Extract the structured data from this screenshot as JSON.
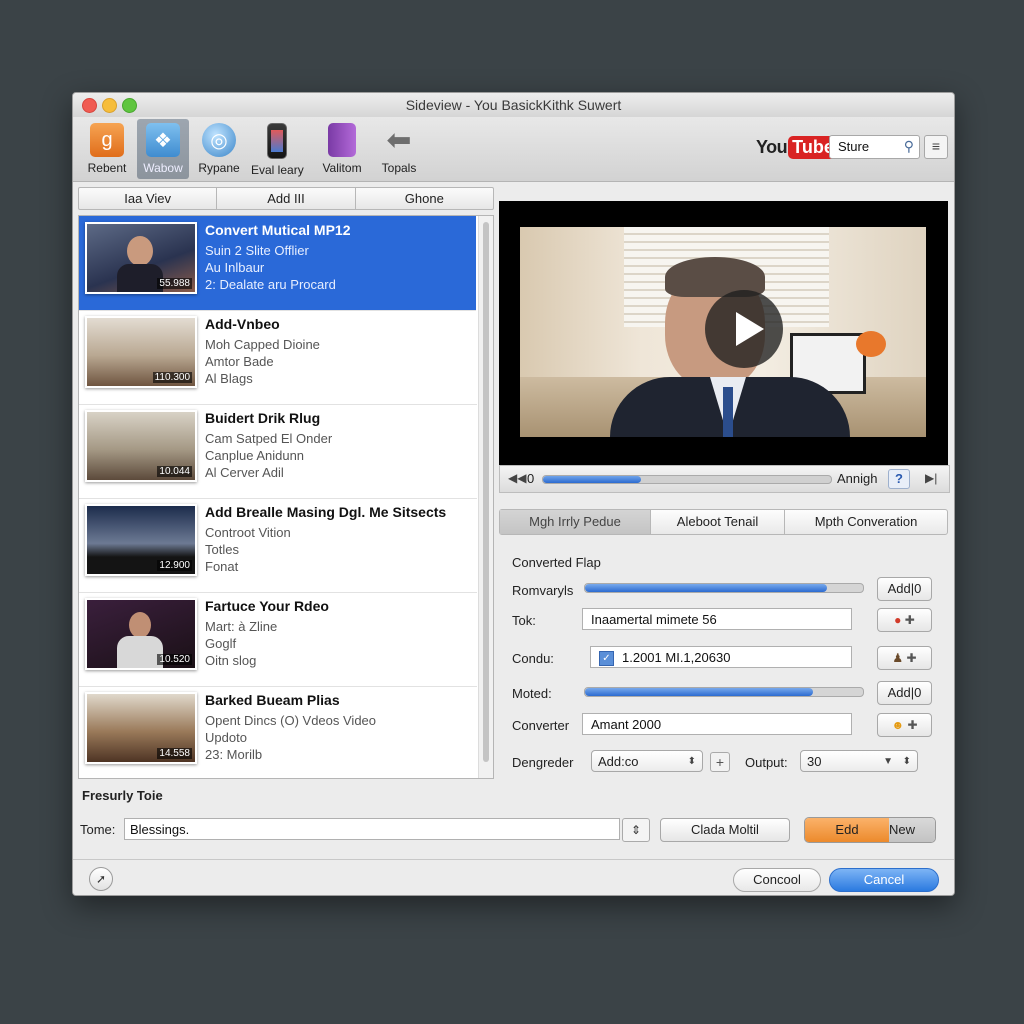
{
  "window": {
    "title": "Sideview - You BasickKithk Suwert"
  },
  "toolbar": {
    "items": [
      {
        "label": "Rebent",
        "icon": "google-icon",
        "color": "#f08a2c"
      },
      {
        "label": "Wabow",
        "icon": "windows-icon",
        "color": "#5aa0d8"
      },
      {
        "label": "Rypane",
        "icon": "globe-icon",
        "color": "#3b86c9"
      },
      {
        "label": "Eval leary",
        "icon": "phone-icon",
        "color": "#4a4a4a"
      },
      {
        "label": "Valitom",
        "icon": "book-icon",
        "color": "#9a4fc1"
      },
      {
        "label": "Topals",
        "icon": "arrow-left-icon",
        "color": "#6e6e6e"
      }
    ],
    "active_index": 1,
    "youtube": {
      "you": "You",
      "tube": "Tube"
    },
    "search": {
      "value": "Sture"
    }
  },
  "left_tabs": [
    "Iaa Viev",
    "Add III",
    "Ghone"
  ],
  "list": [
    {
      "title": "Convert Mutical MP12",
      "lines": [
        "Suin 2 Slite Offlier",
        "Au Inlbaur",
        "2: Dealate aru Procard"
      ],
      "duration": "55.988"
    },
    {
      "title": "Add-Vnbeo",
      "lines": [
        "Moh Capped Dioine",
        "Amtor Bade",
        "Al Blags"
      ],
      "duration": "110.300"
    },
    {
      "title": "Buidert Drik Rlug",
      "lines": [
        "Cam Satped El Onder",
        "Canplue Anidunn",
        "Al Cerver Adil"
      ],
      "duration": "10.044"
    },
    {
      "title": "Add Brealle Masing Dgl. Me Sitsects",
      "lines": [
        "Controot Vition",
        "Totles",
        "Fonat"
      ],
      "duration": "12.900"
    },
    {
      "title": "Fartuce Your Rdeo",
      "lines": [
        "Mart: à Zline",
        "Goglf",
        "Oitn slog"
      ],
      "duration": "10.520"
    },
    {
      "title": "Barked Bueam Plias",
      "lines": [
        "Opent Dincs (O) Vdeos Video",
        "Updoto",
        "23: Morilb"
      ],
      "duration": "14.558"
    }
  ],
  "player": {
    "time": "0",
    "lang": "Annigh",
    "help": "?",
    "progress": 0.34
  },
  "right_tabs": [
    "Mgh Irrly Pedue",
    "Aleboot Tenail",
    "Mpth Converation"
  ],
  "converted": {
    "title": "Converted Flap",
    "rows": [
      {
        "label": "Romvaryls",
        "type": "slider",
        "fill": 0.87,
        "button": "Add|0"
      },
      {
        "label": "Tok:",
        "type": "input",
        "value": "Inaamertal mimete 56",
        "icon": "apple-icon"
      },
      {
        "label": "Condu:",
        "type": "input-check",
        "value": "1.2001 MI.1,20630",
        "icon": "person-icon"
      },
      {
        "label": "Moted:",
        "type": "slider",
        "fill": 0.82,
        "button": "Add|0"
      },
      {
        "label": "Converter",
        "type": "input",
        "value": "Amant 2000",
        "icon": "smiley-icon"
      }
    ],
    "dengreder": {
      "label": "Dengreder",
      "value": "Add:co"
    },
    "output": {
      "label": "Output:",
      "value": "30"
    }
  },
  "favorites": {
    "title": "Fresurly Toie"
  },
  "tome": {
    "label": "Tome:",
    "value": "Blessings.",
    "button": "Clada Moltil"
  },
  "edit_button": {
    "left": "Edd",
    "right": "New"
  },
  "footer": {
    "cancel": "Concool",
    "ok": "Cancel"
  },
  "colors": {
    "accent": "#2a69d8",
    "ok_button": "#2b7ae0",
    "edit_button": "#ec8a2c"
  }
}
